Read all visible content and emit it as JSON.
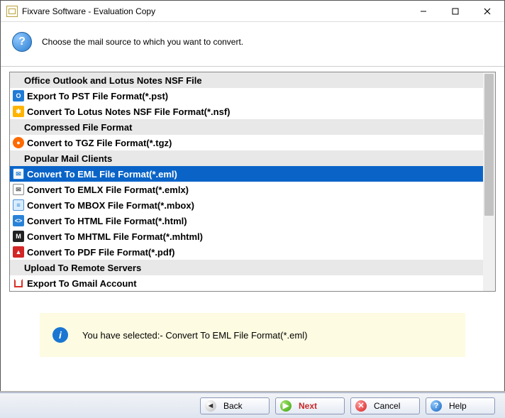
{
  "window": {
    "title": "Fixvare Software - Evaluation Copy"
  },
  "header": {
    "prompt": "Choose the mail source to which you want to convert."
  },
  "list": [
    {
      "kind": "header",
      "label": "Office Outlook and Lotus Notes NSF File"
    },
    {
      "kind": "item",
      "icon": "pst-icon",
      "label": "Export To PST File Format(*.pst)"
    },
    {
      "kind": "item",
      "icon": "nsf-icon",
      "label": "Convert To Lotus Notes NSF File Format(*.nsf)"
    },
    {
      "kind": "header",
      "label": "Compressed File Format"
    },
    {
      "kind": "item",
      "icon": "tgz-icon",
      "label": "Convert to TGZ File Format(*.tgz)"
    },
    {
      "kind": "header",
      "label": "Popular Mail Clients"
    },
    {
      "kind": "item",
      "icon": "eml-icon",
      "label": "Convert To EML File Format(*.eml)",
      "selected": true
    },
    {
      "kind": "item",
      "icon": "emlx-icon",
      "label": "Convert To EMLX File Format(*.emlx)"
    },
    {
      "kind": "item",
      "icon": "mbox-icon",
      "label": "Convert To MBOX File Format(*.mbox)"
    },
    {
      "kind": "item",
      "icon": "html-icon",
      "label": "Convert To HTML File Format(*.html)"
    },
    {
      "kind": "item",
      "icon": "mhtml-icon",
      "label": "Convert To MHTML File Format(*.mhtml)"
    },
    {
      "kind": "item",
      "icon": "pdf-icon",
      "label": "Convert To PDF File Format(*.pdf)"
    },
    {
      "kind": "header",
      "label": "Upload To Remote Servers"
    },
    {
      "kind": "item",
      "icon": "gmail-icon",
      "label": "Export To Gmail Account"
    }
  ],
  "info": {
    "message": "You have selected:- Convert To EML File Format(*.eml)"
  },
  "buttons": {
    "back": "Back",
    "next": "Next",
    "cancel": "Cancel",
    "help": "Help"
  }
}
